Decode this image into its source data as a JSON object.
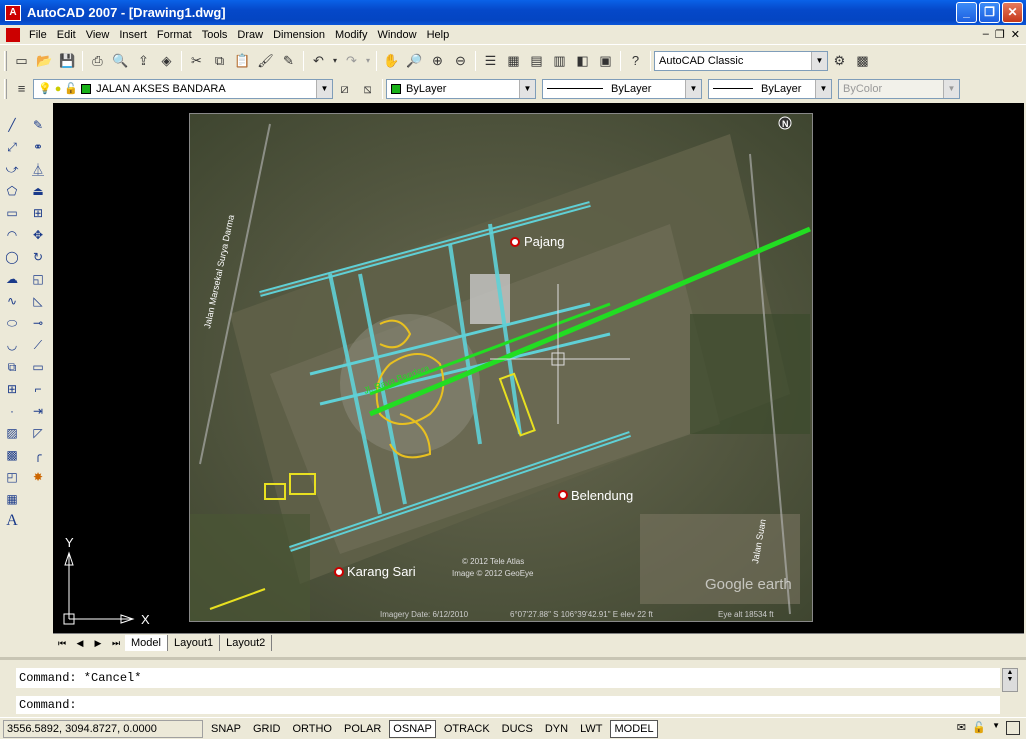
{
  "window": {
    "title": "AutoCAD 2007 - [Drawing1.dwg]"
  },
  "menu": [
    "File",
    "Edit",
    "View",
    "Insert",
    "Format",
    "Tools",
    "Draw",
    "Dimension",
    "Modify",
    "Window",
    "Help"
  ],
  "workspace": {
    "value": "AutoCAD Classic"
  },
  "layer": {
    "value": "JALAN AKSES BANDARA",
    "color": "#18b018"
  },
  "properties": {
    "color": "ByLayer",
    "linetype": "ByLayer",
    "lineweight": "ByLayer",
    "plotstyle": "ByColor"
  },
  "map": {
    "labels": [
      "Pajang",
      "Belendung",
      "Karang Sari",
      "Jalan Marsekal Surya Darma",
      "Jl. Raya Bandara",
      "Jalan Suan"
    ],
    "copyright": [
      "© 2012 Tele Atlas",
      "Image © 2012 GeoEye"
    ],
    "google": "Google earth",
    "imagery": "Imagery Date: 6/12/2010",
    "coords": "6°07'27.88\" S  106°39'42.91\" E  elev  22 ft",
    "eye": "Eye alt  18534 ft",
    "north": "N"
  },
  "ucs": {
    "x": "X",
    "y": "Y"
  },
  "tabs": [
    "Model",
    "Layout1",
    "Layout2"
  ],
  "command": {
    "history": "Command: *Cancel*",
    "prompt": "Command:"
  },
  "status": {
    "coords": "3556.5892, 3094.8727, 0.0000",
    "buttons": [
      "SNAP",
      "GRID",
      "ORTHO",
      "POLAR",
      "OSNAP",
      "OTRACK",
      "DUCS",
      "DYN",
      "LWT",
      "MODEL"
    ],
    "active": [
      "OSNAP",
      "MODEL"
    ]
  }
}
